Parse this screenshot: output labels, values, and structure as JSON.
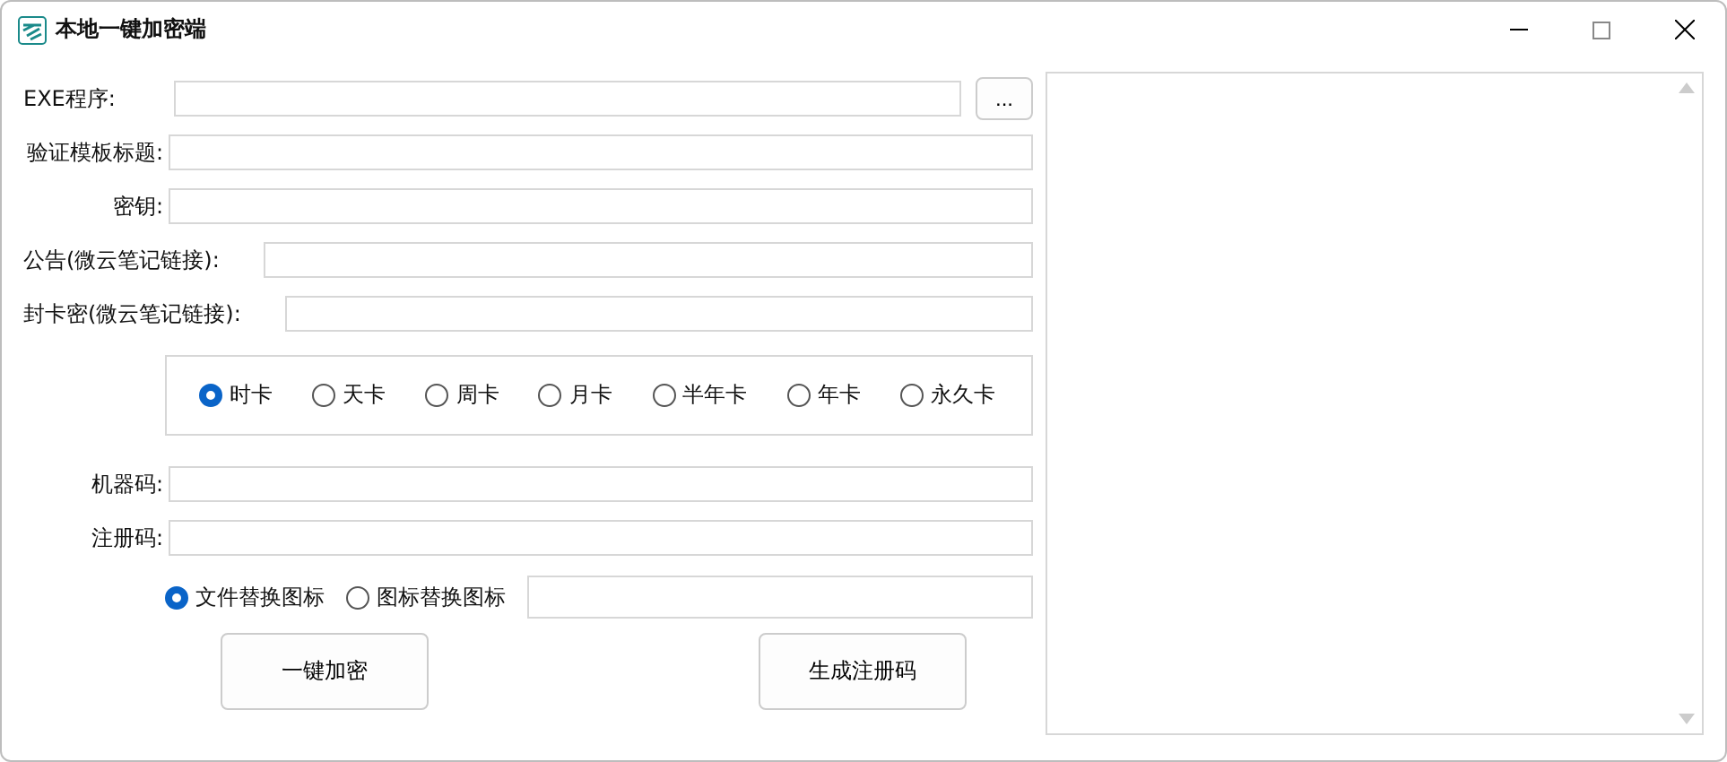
{
  "window": {
    "title": "本地一键加密端"
  },
  "fields_top": [
    {
      "label": "EXE程序:",
      "kind": "browse",
      "button": "..."
    },
    {
      "label": "验证模板标题:",
      "kind": "plain"
    },
    {
      "label": "密钥:",
      "kind": "plain"
    },
    {
      "label": "公告(微云笔记链接):",
      "kind": "wide"
    },
    {
      "label": "封卡密(微云笔记链接):",
      "kind": "wide"
    }
  ],
  "card_types": [
    {
      "label": "时卡",
      "selected": true
    },
    {
      "label": "天卡",
      "selected": false
    },
    {
      "label": "周卡",
      "selected": false
    },
    {
      "label": "月卡",
      "selected": false
    },
    {
      "label": "半年卡",
      "selected": false
    },
    {
      "label": "年卡",
      "selected": false
    },
    {
      "label": "永久卡",
      "selected": false
    }
  ],
  "fields_bottom": [
    {
      "label": "机器码:"
    },
    {
      "label": "注册码:"
    }
  ],
  "icon_modes": [
    {
      "label": "文件替换图标",
      "selected": true
    },
    {
      "label": "图标替换图标",
      "selected": false
    }
  ],
  "buttons": [
    "一键加密",
    "生成注册码"
  ]
}
